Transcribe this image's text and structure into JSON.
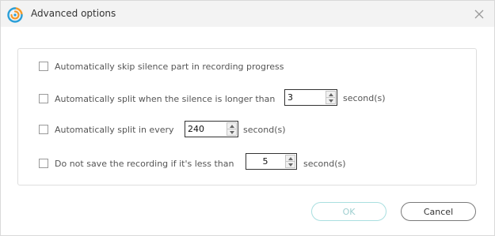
{
  "window": {
    "title": "Advanced options",
    "logo_icon": "app-logo-icon",
    "close_icon": "close-icon"
  },
  "options": [
    {
      "label": "Automatically skip silence part in recording progress",
      "checked": false
    },
    {
      "label": "Automatically split when the silence is longer than",
      "checked": false,
      "value": "3",
      "unit": "second(s)"
    },
    {
      "label": "Automatically split in every",
      "checked": false,
      "value": "240",
      "unit": "second(s)"
    },
    {
      "label": "Do not save the recording if it's less than",
      "checked": false,
      "value": "5",
      "unit": "second(s)"
    }
  ],
  "buttons": {
    "ok": "OK",
    "cancel": "Cancel"
  },
  "colors": {
    "titlebar": "#f3f3f3",
    "ok_border": "#a9dfe0",
    "ok_text": "#9fcfd0",
    "logo_orange": "#f39a2b",
    "logo_blue": "#2a9fd8"
  }
}
